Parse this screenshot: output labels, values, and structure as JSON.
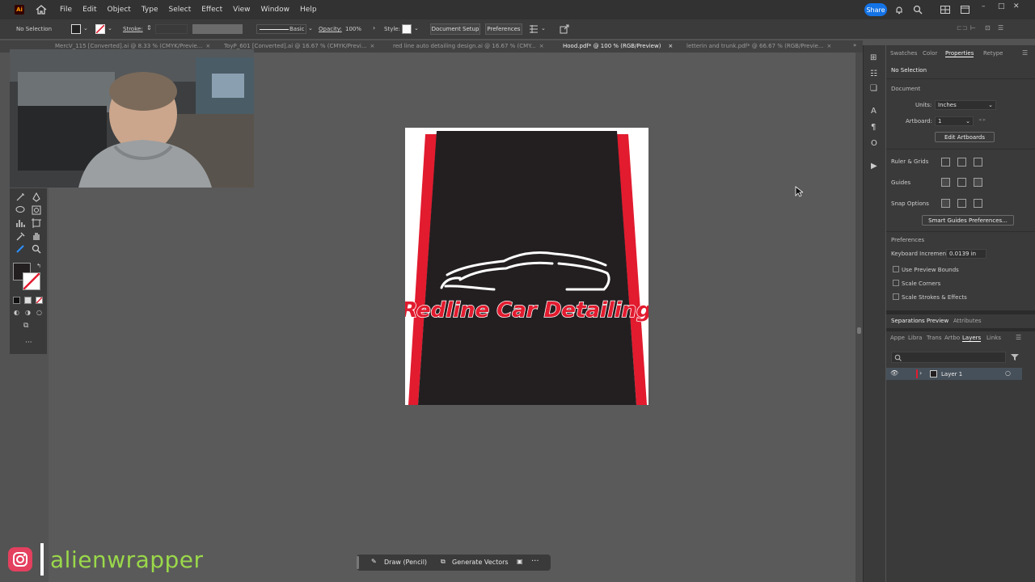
{
  "app": {
    "logo": "Ai"
  },
  "menu": [
    "File",
    "Edit",
    "Object",
    "Type",
    "Select",
    "Effect",
    "View",
    "Window",
    "Help"
  ],
  "share_label": "Share",
  "control_bar": {
    "selection": "No Selection",
    "stroke_label": "Stroke:",
    "basic_label": "Basic",
    "opacity_label": "Opacity:",
    "opacity_value": "100%",
    "style_label": "Style:",
    "document_setup": "Document Setup",
    "preferences": "Preferences"
  },
  "tabs": [
    {
      "label": "MercV_115 [Converted].ai @ 8.33 % (CMYK/Previe...",
      "active": false
    },
    {
      "label": "ToyP_601 [Converted].ai @ 16.67 % (CMYK/Previ...",
      "active": false
    },
    {
      "label": "red line auto detailing design.ai @ 16.67 % (CMY...",
      "active": false
    },
    {
      "label": "Hood.pdf* @ 100 % (RGB/Preview)",
      "active": true
    },
    {
      "label": "letterin and trunk.pdf* @ 66.67 % (RGB/Previe...",
      "active": false
    }
  ],
  "artwork": {
    "brand_text": "Redline Car Detailing",
    "colors": {
      "background": "#231f20",
      "stripe": "#e21b2f",
      "text": "#e21b2f"
    }
  },
  "right_panel": {
    "tabs": [
      {
        "label": "Swatches",
        "active": false
      },
      {
        "label": "Color",
        "active": false
      },
      {
        "label": "Properties",
        "active": true
      },
      {
        "label": "Retype",
        "active": false
      }
    ],
    "no_selection": "No Selection",
    "document_heading": "Document",
    "units_label": "Units:",
    "units_value": "Inches",
    "artboard_label": "Artboard:",
    "artboard_value": "1",
    "edit_artboards": "Edit Artboards",
    "ruler_grids": "Ruler & Grids",
    "guides": "Guides",
    "snap_options": "Snap Options",
    "smart_guides": "Smart Guides Preferences...",
    "preferences_heading": "Preferences",
    "keyboard_increment_label": "Keyboard Increment:",
    "keyboard_increment_value": "0.0139 in",
    "checkboxes": [
      "Use Preview Bounds",
      "Scale Corners",
      "Scale Strokes & Effects"
    ],
    "lower_tabs": [
      "Separations Preview",
      "Attributes"
    ],
    "layer_tabs": [
      "Appe",
      "Libra",
      "Trans",
      "Artbo",
      "Layers",
      "Links"
    ],
    "layer_name": "Layer 1"
  },
  "bottom_bar": {
    "draw": "Draw (Pencil)",
    "generate": "Generate Vectors"
  },
  "watermark": "alienwrapper"
}
